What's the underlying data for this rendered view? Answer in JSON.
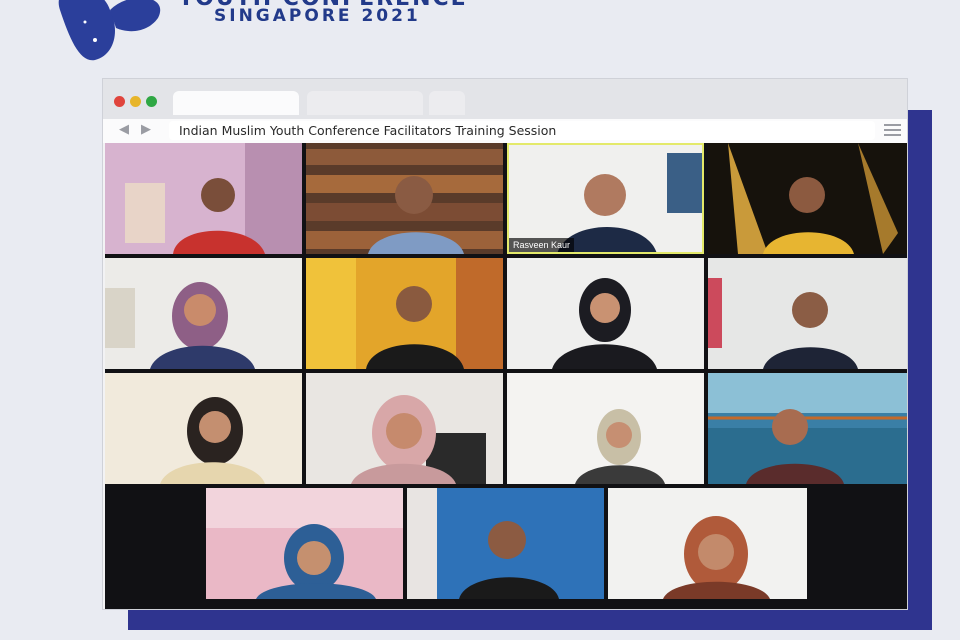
{
  "branding": {
    "title": "YOUTH CONFERENCE",
    "subtitle": "SINGAPORE 2021",
    "logo_icon": "butterfly-logo-icon",
    "brand_color": "#223a8a"
  },
  "browser": {
    "window_controls": [
      "close",
      "minimize",
      "maximize"
    ],
    "address_text": "Indian Muslim Youth Conference Facilitators Training Session",
    "back_icon": "back-arrow-icon",
    "forward_icon": "forward-arrow-icon",
    "menu_icon": "hamburger-menu-icon"
  },
  "meeting": {
    "participants": [
      {
        "label": "",
        "active": false
      },
      {
        "label": "",
        "active": false
      },
      {
        "label": "Rasveen Kaur",
        "active": true
      },
      {
        "label": "",
        "active": false
      },
      {
        "label": "",
        "active": false
      },
      {
        "label": "",
        "active": false
      },
      {
        "label": "",
        "active": false
      },
      {
        "label": "",
        "active": false
      },
      {
        "label": "",
        "active": false
      },
      {
        "label": "",
        "active": false
      },
      {
        "label": "",
        "active": false
      },
      {
        "label": "",
        "active": false
      },
      {
        "label": "",
        "active": false
      },
      {
        "label": "",
        "active": false
      },
      {
        "label": "",
        "active": false
      }
    ]
  }
}
